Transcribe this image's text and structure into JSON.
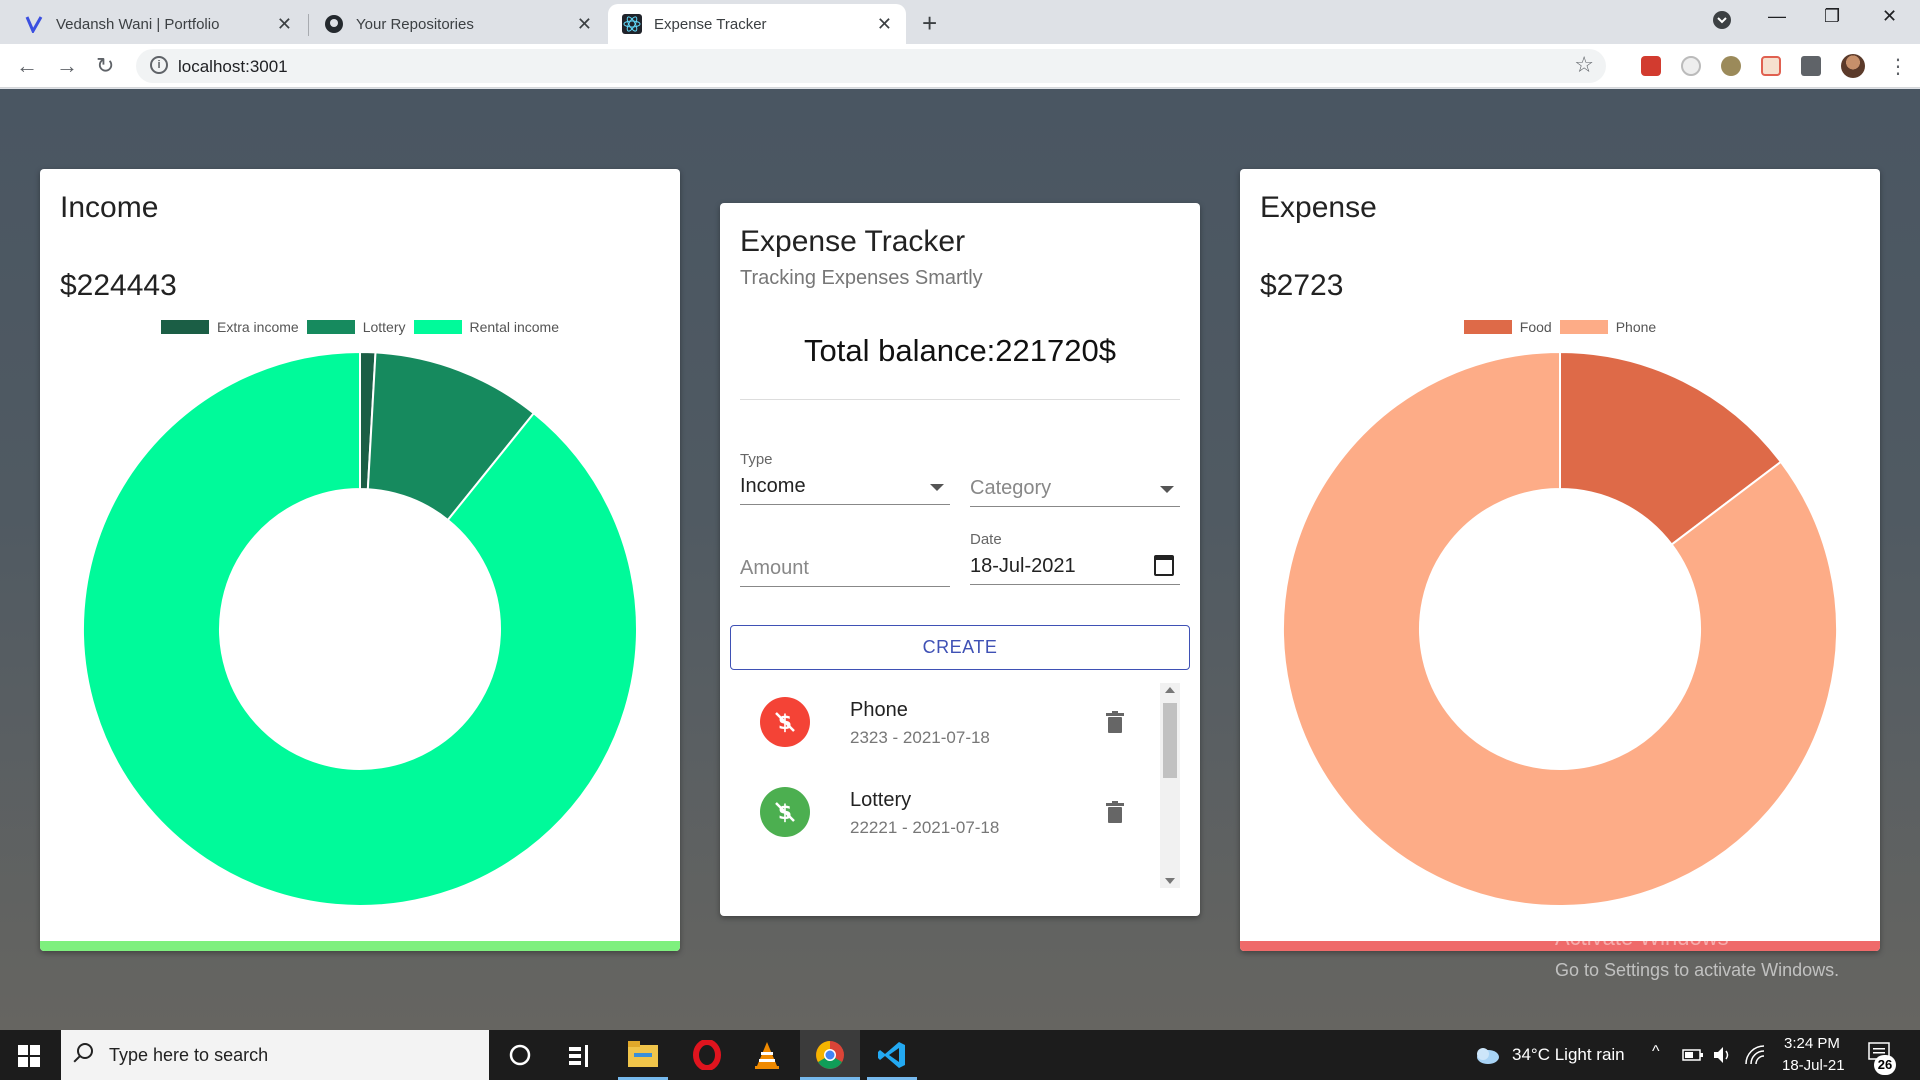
{
  "browser": {
    "tabs": [
      {
        "title": "Vedansh Wani | Portfolio",
        "icon": "v-logo-icon"
      },
      {
        "title": "Your Repositories",
        "icon": "github-icon"
      },
      {
        "title": "Expense Tracker",
        "icon": "react-icon",
        "active": true
      }
    ],
    "url": "localhost:3001"
  },
  "income": {
    "title": "Income",
    "amount": "$224443",
    "legend": [
      "Extra income",
      "Lottery",
      "Rental income"
    ],
    "bar_color": "#7ef07e"
  },
  "expense": {
    "title": "Expense",
    "amount": "$2723",
    "legend": [
      "Food",
      "Phone"
    ],
    "bar_color": "#ef6a6a"
  },
  "tracker": {
    "title": "Expense Tracker",
    "subtitle": "Tracking Expenses Smartly",
    "balance": "Total balance:221720$",
    "type_label": "Type",
    "type_value": "Income",
    "category_placeholder": "Category",
    "amount_placeholder": "Amount",
    "date_label": "Date",
    "date_value": "18-Jul-2021",
    "create_label": "CREATE",
    "transactions": [
      {
        "name": "Phone",
        "detail": "2323 - 2021-07-18",
        "kind": "expense",
        "color": "#f44336"
      },
      {
        "name": "Lottery",
        "detail": "22221 - 2021-07-18",
        "kind": "income",
        "color": "#4caf50"
      }
    ]
  },
  "watermark": {
    "line1": "Activate Windows",
    "line2": "Go to Settings to activate Windows."
  },
  "taskbar": {
    "search_placeholder": "Type here to search",
    "weather": "34°C  Light rain",
    "time": "3:24 PM",
    "date": "18-Jul-21",
    "notifications": "26"
  },
  "chart_data": [
    {
      "type": "pie",
      "title": "Income",
      "categories": [
        "Extra income",
        "Lottery",
        "Rental income"
      ],
      "values": [
        2000,
        22221,
        200222
      ],
      "colors": [
        "#1b5e45",
        "#168a5e",
        "#00fa9a"
      ],
      "donut": true,
      "legend": "top"
    },
    {
      "type": "pie",
      "title": "Expense",
      "categories": [
        "Food",
        "Phone"
      ],
      "values": [
        400,
        2323
      ],
      "colors": [
        "#de6a48",
        "#fdac87"
      ],
      "donut": true,
      "legend": "top"
    }
  ]
}
